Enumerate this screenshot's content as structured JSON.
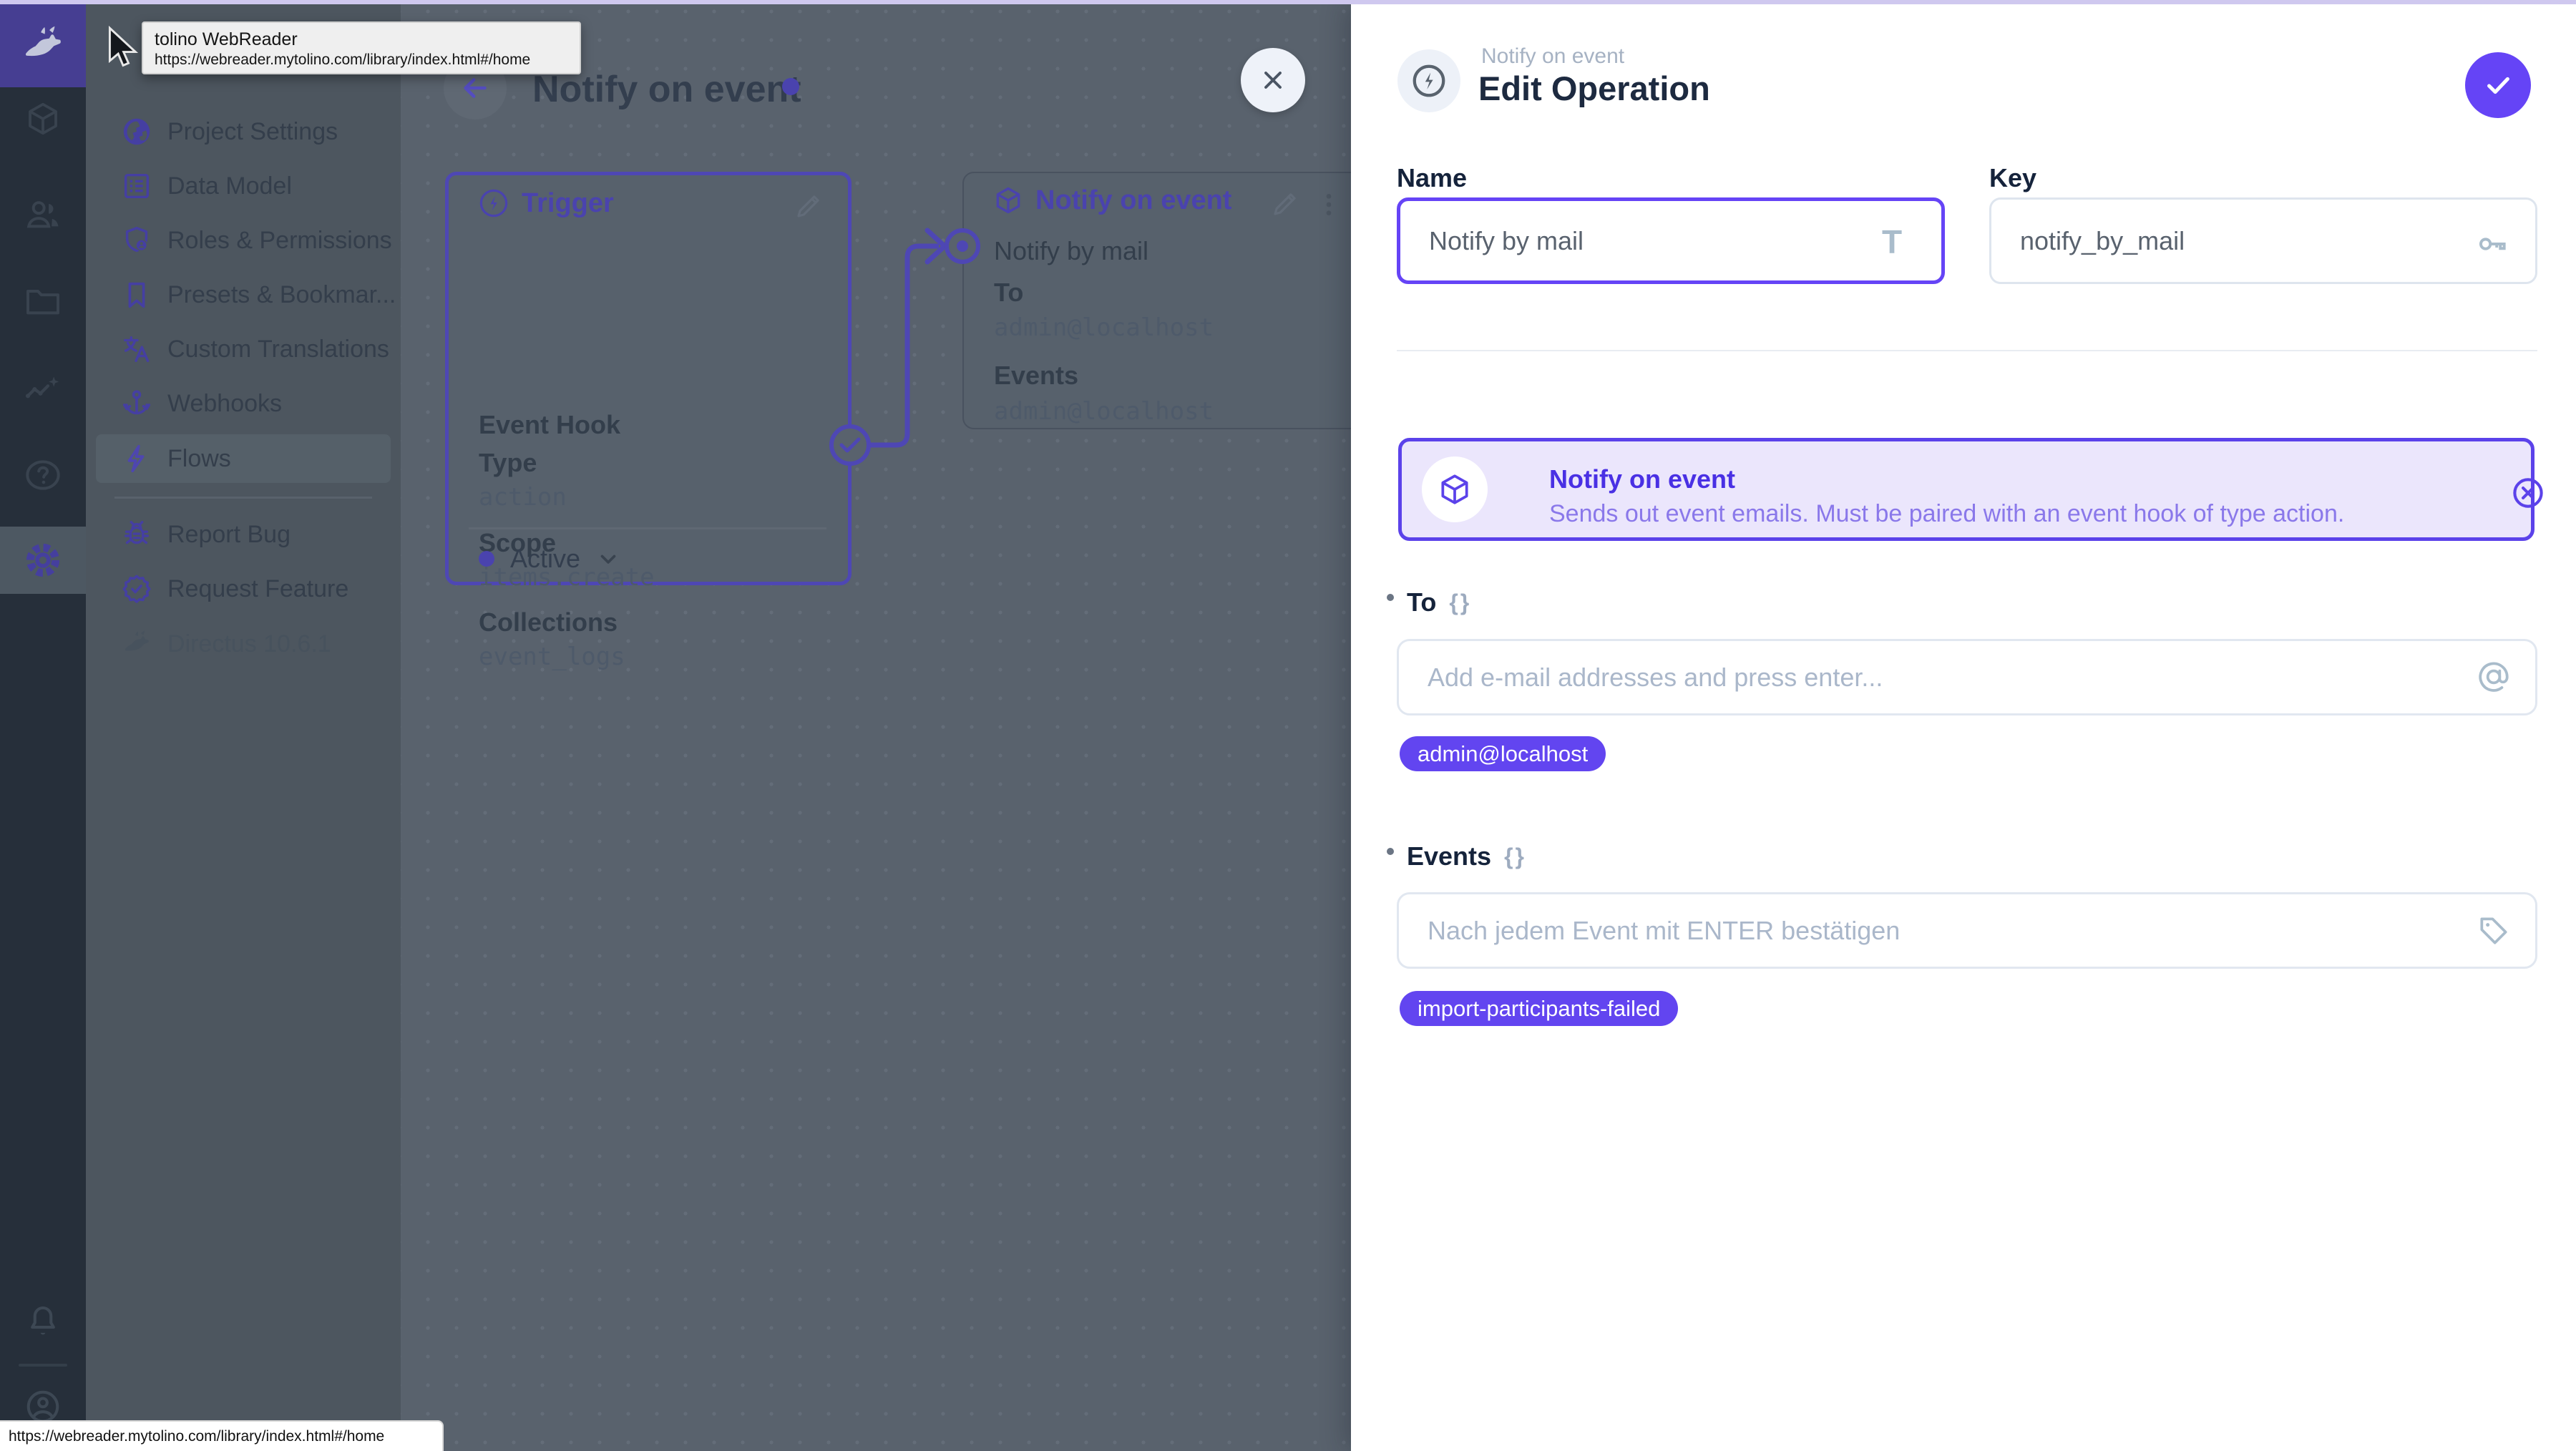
{
  "tooltip": {
    "title": "tolino WebReader",
    "url": "https://webreader.mytolino.com/library/index.html#/home"
  },
  "status_bar": {
    "url": "https://webreader.mytolino.com/library/index.html#/home"
  },
  "sidebar": {
    "items": [
      {
        "label": "Project Settings"
      },
      {
        "label": "Data Model"
      },
      {
        "label": "Roles & Permissions"
      },
      {
        "label": "Presets & Bookmar..."
      },
      {
        "label": "Custom Translations"
      },
      {
        "label": "Webhooks"
      },
      {
        "label": "Flows"
      }
    ],
    "footer_items": [
      {
        "label": "Report Bug"
      },
      {
        "label": "Request Feature"
      }
    ],
    "version": "Directus 10.6.1"
  },
  "flow": {
    "title": "Notify on event",
    "trigger_card": {
      "header": "Trigger",
      "row1_label": "Event Hook",
      "row2_label": "Type",
      "row2_value": "action",
      "row3_label": "Scope",
      "row3_value": "items.create",
      "row4_label": "Collections",
      "row4_value": "event_logs",
      "status": "Active"
    },
    "operation_card": {
      "header": "Notify on event",
      "name": "Notify by mail",
      "row1_label": "To",
      "row1_value": "admin@localhost",
      "row2_label": "Events",
      "row2_value": "admin@localhost"
    }
  },
  "drawer": {
    "context_label": "Notify on event",
    "title": "Edit Operation",
    "name_field": {
      "label": "Name",
      "value": "Notify by mail"
    },
    "key_field": {
      "label": "Key",
      "value": "notify_by_mail"
    },
    "banner": {
      "title": "Notify on event",
      "description": "Sends out event emails. Must be paired with an event hook of type action."
    },
    "to_field": {
      "label": "To",
      "braces": "{}",
      "placeholder": "Add e-mail addresses and press enter...",
      "chip": "admin@localhost"
    },
    "events_field": {
      "label": "Events",
      "braces": "{}",
      "placeholder": "Nach jedem Event mit ENTER bestätigen",
      "chip": "import-participants-failed"
    }
  },
  "colors": {
    "accent": "#6644FF",
    "banner_bg": "#ebe6fc",
    "chip_bg": "#6245f0"
  }
}
